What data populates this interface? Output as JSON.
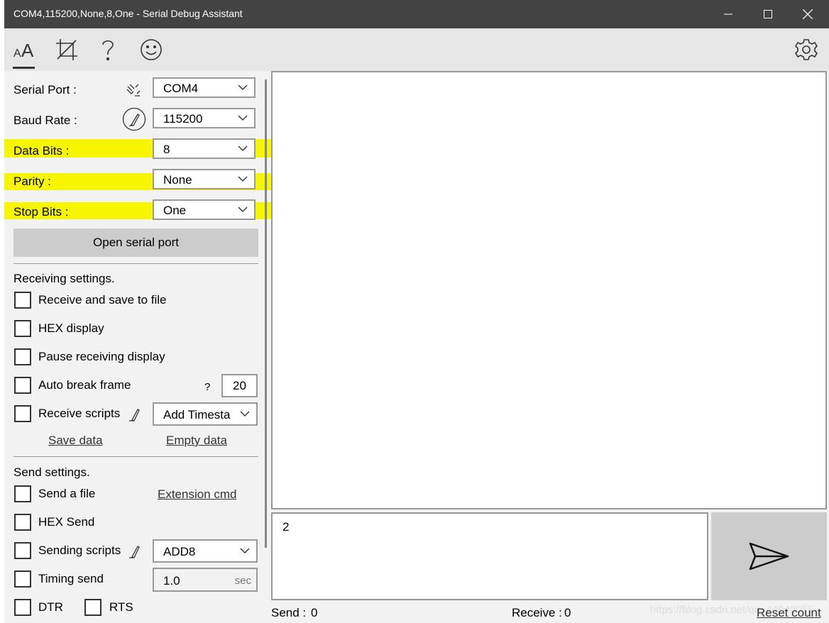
{
  "window": {
    "title": "COM4,115200,None,8,One - Serial Debug Assistant"
  },
  "toolbar": {
    "icons": [
      "font-icon",
      "crop-icon",
      "help-icon",
      "smiley-icon",
      "gear-icon"
    ]
  },
  "serial": {
    "port_label": "Serial Port :",
    "port_value": "COM4",
    "baud_label": "Baud Rate :",
    "baud_value": "115200",
    "databits_label": "Data Bits :",
    "databits_value": "8",
    "parity_label": "Parity :",
    "parity_value": "None",
    "stopbits_label": "Stop Bits :",
    "stopbits_value": "One",
    "open_button": "Open serial port",
    "highlight_color": "#f6f600"
  },
  "receiving": {
    "heading": "Receiving settings.",
    "save_to_file": "Receive and save to file",
    "hex_display": "HEX display",
    "pause_display": "Pause receiving display",
    "auto_break": "Auto break frame",
    "auto_break_help": "?",
    "auto_break_value": "20",
    "scripts": "Receive scripts",
    "scripts_value": "Add Timesta",
    "save_data": "Save data",
    "empty_data": "Empty data"
  },
  "sending": {
    "heading": "Send settings.",
    "send_file": "Send a file",
    "extension_cmd": "Extension cmd",
    "hex_send": "HEX Send",
    "scripts": "Sending scripts",
    "scripts_value": "ADD8",
    "timing_send": "Timing send",
    "timing_value": "1.0",
    "timing_unit": "sec",
    "dtr": "DTR",
    "rts": "RTS"
  },
  "send_input": {
    "value": "2"
  },
  "status": {
    "send_label": "Send :",
    "send_count": "0",
    "receive_label": "Receive :",
    "receive_count": "0",
    "reset": "Reset count"
  },
  "watermark": "https://blog.csdn.net/qq_44040055"
}
